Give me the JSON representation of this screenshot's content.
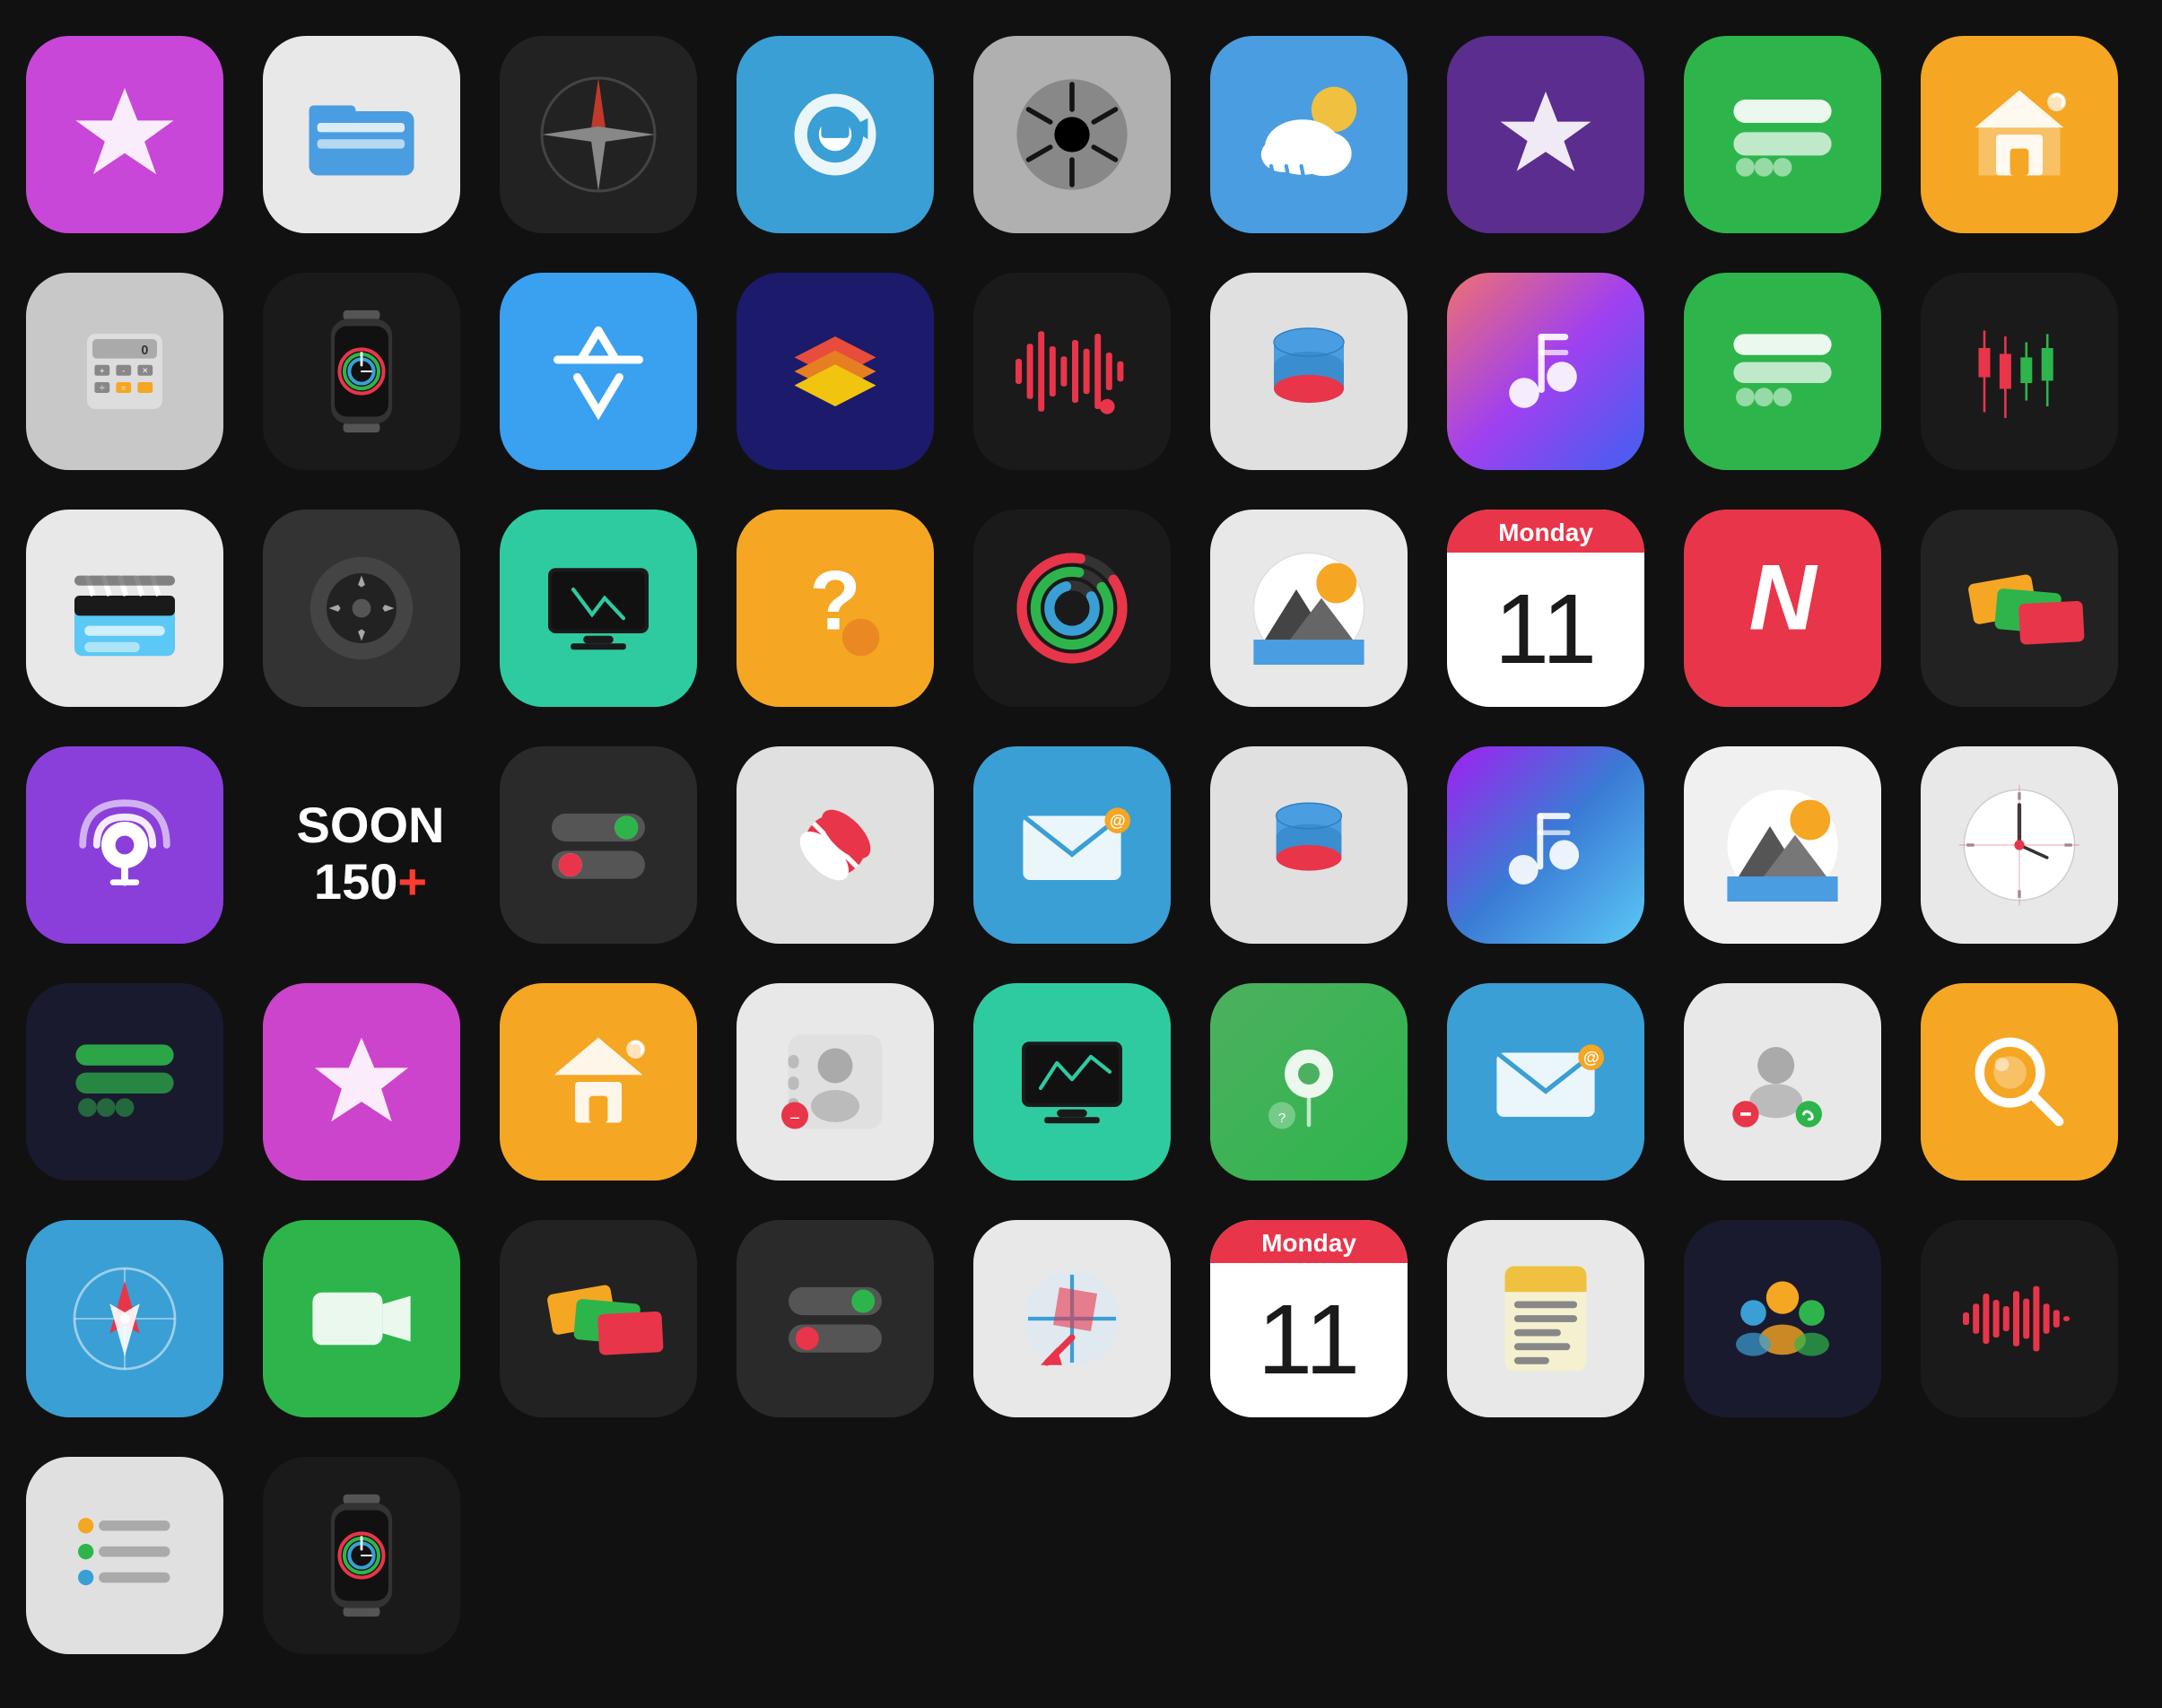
{
  "grid": {
    "soon_label": "SOON",
    "soon_count": "150",
    "soon_plus": "+",
    "calendar_day": "11",
    "calendar_month": "Monday"
  }
}
